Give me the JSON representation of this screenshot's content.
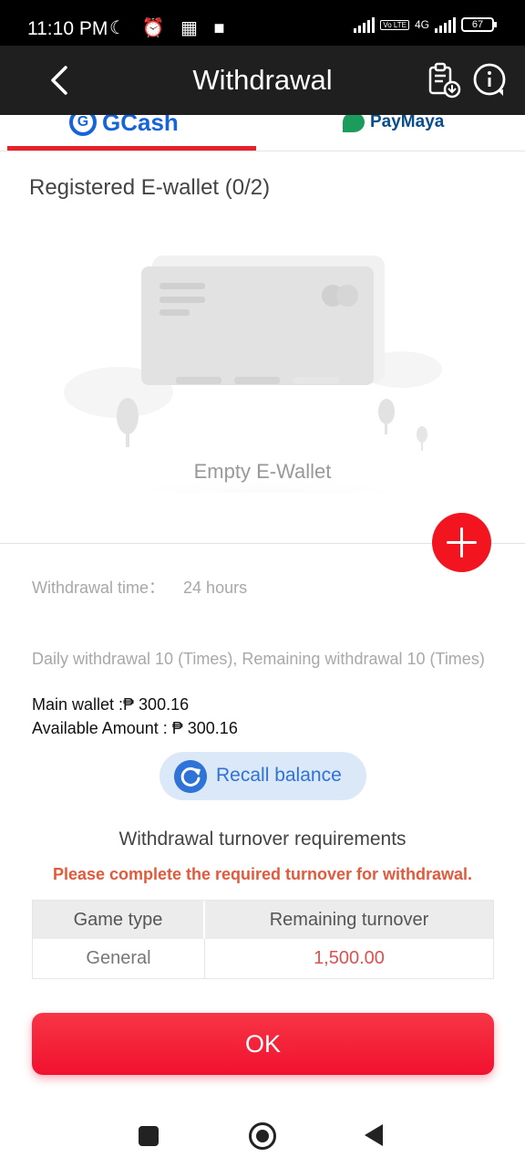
{
  "status_bar": {
    "time": "11:10 PM",
    "network": "4G",
    "volte": "Vo LTE",
    "battery": "67"
  },
  "header": {
    "title": "Withdrawal",
    "icons": [
      "back-icon",
      "clipboard-download-icon",
      "info-icon"
    ]
  },
  "tabs": [
    {
      "label": "GCash",
      "active": true
    },
    {
      "label": "PayMaya",
      "active": false
    }
  ],
  "wallet": {
    "title": "Registered E-wallet (0/2)",
    "empty_label": "Empty E-Wallet"
  },
  "info": {
    "withdrawal_time_label": "Withdrawal time：",
    "withdrawal_time_value": "24 hours",
    "daily": "Daily withdrawal 10 (Times), Remaining withdrawal 10 (Times)",
    "main_wallet": "Main wallet :₱ 300.16",
    "available": "Available Amount : ₱ 300.16"
  },
  "recall": {
    "label": "Recall balance"
  },
  "turnover": {
    "title": "Withdrawal turnover requirements",
    "warning": "Please complete the required turnover for withdrawal.",
    "headers": [
      "Game type",
      "Remaining turnover"
    ],
    "rows": [
      {
        "game_type": "General",
        "remaining": "1,500.00"
      }
    ]
  },
  "ok_button": {
    "label": "OK"
  },
  "colors": {
    "accent": "#e8202a",
    "header_bg": "#1f1f1f",
    "link_blue": "#2f72d8",
    "warning": "#e05a3c"
  }
}
